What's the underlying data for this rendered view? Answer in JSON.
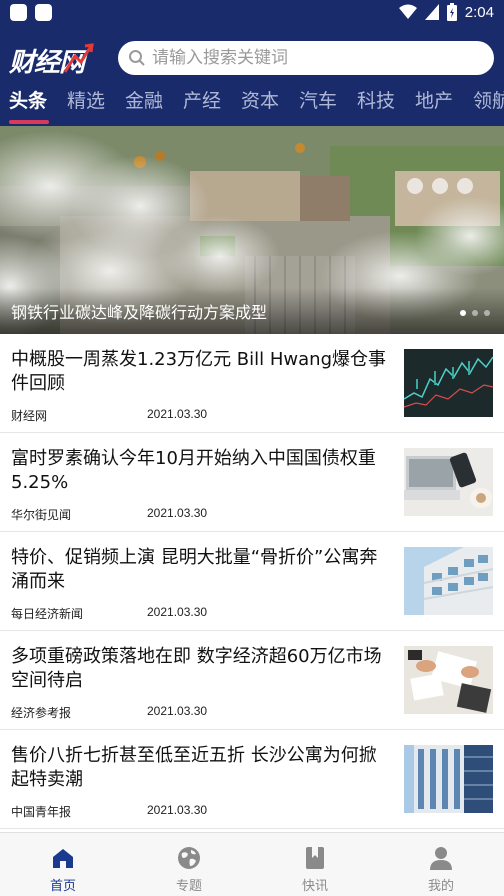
{
  "status_bar": {
    "time": "2:04"
  },
  "header": {
    "logo_text": "财经网",
    "search": {
      "placeholder": "请输入搜索关键词"
    }
  },
  "tabs": [
    {
      "label": "头条",
      "active": true
    },
    {
      "label": "精选"
    },
    {
      "label": "金融"
    },
    {
      "label": "产经"
    },
    {
      "label": "资本"
    },
    {
      "label": "汽车"
    },
    {
      "label": "科技"
    },
    {
      "label": "地产"
    },
    {
      "label": "领航"
    }
  ],
  "banner": {
    "caption": "钢铁行业碳达峰及降碳行动方案成型",
    "slide_count": 3,
    "active_slide": 0
  },
  "news": [
    {
      "title": "中概股一周蒸发1.23万亿元 Bill Hwang爆仓事件回顾",
      "source": "财经网",
      "date": "2021.03.30"
    },
    {
      "title": "富时罗素确认今年10月开始纳入中国国债权重5.25%",
      "source": "华尔街见闻",
      "date": "2021.03.30"
    },
    {
      "title": "特价、促销频上演 昆明大批量“骨折价”公寓奔涌而来",
      "source": "每日经济新闻",
      "date": "2021.03.30"
    },
    {
      "title": "多项重磅政策落地在即 数字经济超60万亿市场空间待启",
      "source": "经济参考报",
      "date": "2021.03.30"
    },
    {
      "title": "售价八折七折甚至低至近五折 长沙公寓为何掀起特卖潮",
      "source": "中国青年报",
      "date": "2021.03.30"
    }
  ],
  "bottom_nav": [
    {
      "label": "首页",
      "icon": "home-icon",
      "active": true
    },
    {
      "label": "专题",
      "icon": "globe-icon"
    },
    {
      "label": "快讯",
      "icon": "bookmark-icon"
    },
    {
      "label": "我的",
      "icon": "user-icon"
    }
  ],
  "colors": {
    "primary": "#1a2b6b",
    "accent": "#d93a5b",
    "nav_active": "#1a3a8f"
  }
}
